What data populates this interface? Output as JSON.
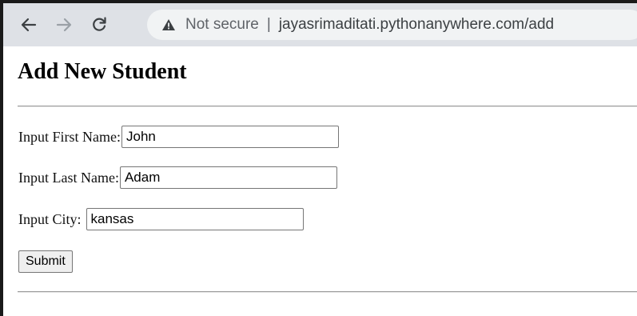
{
  "browser": {
    "security_text": "Not secure",
    "separator": "|",
    "url": "jayasrimaditati.pythonanywhere.com/add",
    "icons": [
      "back-arrow-icon",
      "forward-arrow-icon",
      "reload-icon",
      "warning-triangle-icon"
    ]
  },
  "page": {
    "title": "Add New Student",
    "form": {
      "first_name_label": "Input First Name:",
      "first_name_value": "John",
      "last_name_label": "Input Last Name:",
      "last_name_value": "Adam",
      "city_label": "Input City:",
      "city_value": "kansas",
      "submit_label": "Submit"
    }
  }
}
